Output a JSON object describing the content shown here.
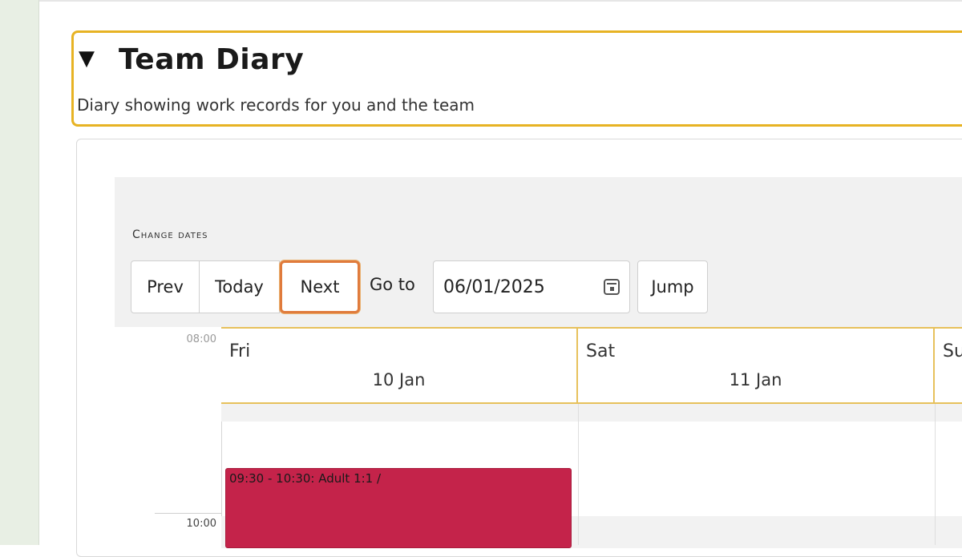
{
  "header": {
    "toggle_icon": "triangle-down-icon",
    "title": "Team Diary",
    "subtitle": "Diary showing work records for you and the team"
  },
  "toolbar": {
    "change_dates_label": "Change dates",
    "prev_label": "Prev",
    "today_label": "Today",
    "next_label": "Next",
    "goto_label": "Go to",
    "date_value": "06/01/2025",
    "jump_label": "Jump"
  },
  "calendar": {
    "times": [
      "08:00",
      "10:00"
    ],
    "days": [
      {
        "name": "Fri",
        "date": "10 Jan"
      },
      {
        "name": "Sat",
        "date": "11 Jan"
      },
      {
        "name": "Sun",
        "date": ""
      }
    ],
    "events": [
      {
        "label": "09:30 - 10:30: Adult 1:1 /",
        "color": "#c4234a"
      }
    ]
  },
  "colors": {
    "accent": "#e7b324",
    "focus": "#e07b3c",
    "sidebar": "#e8efe4"
  }
}
